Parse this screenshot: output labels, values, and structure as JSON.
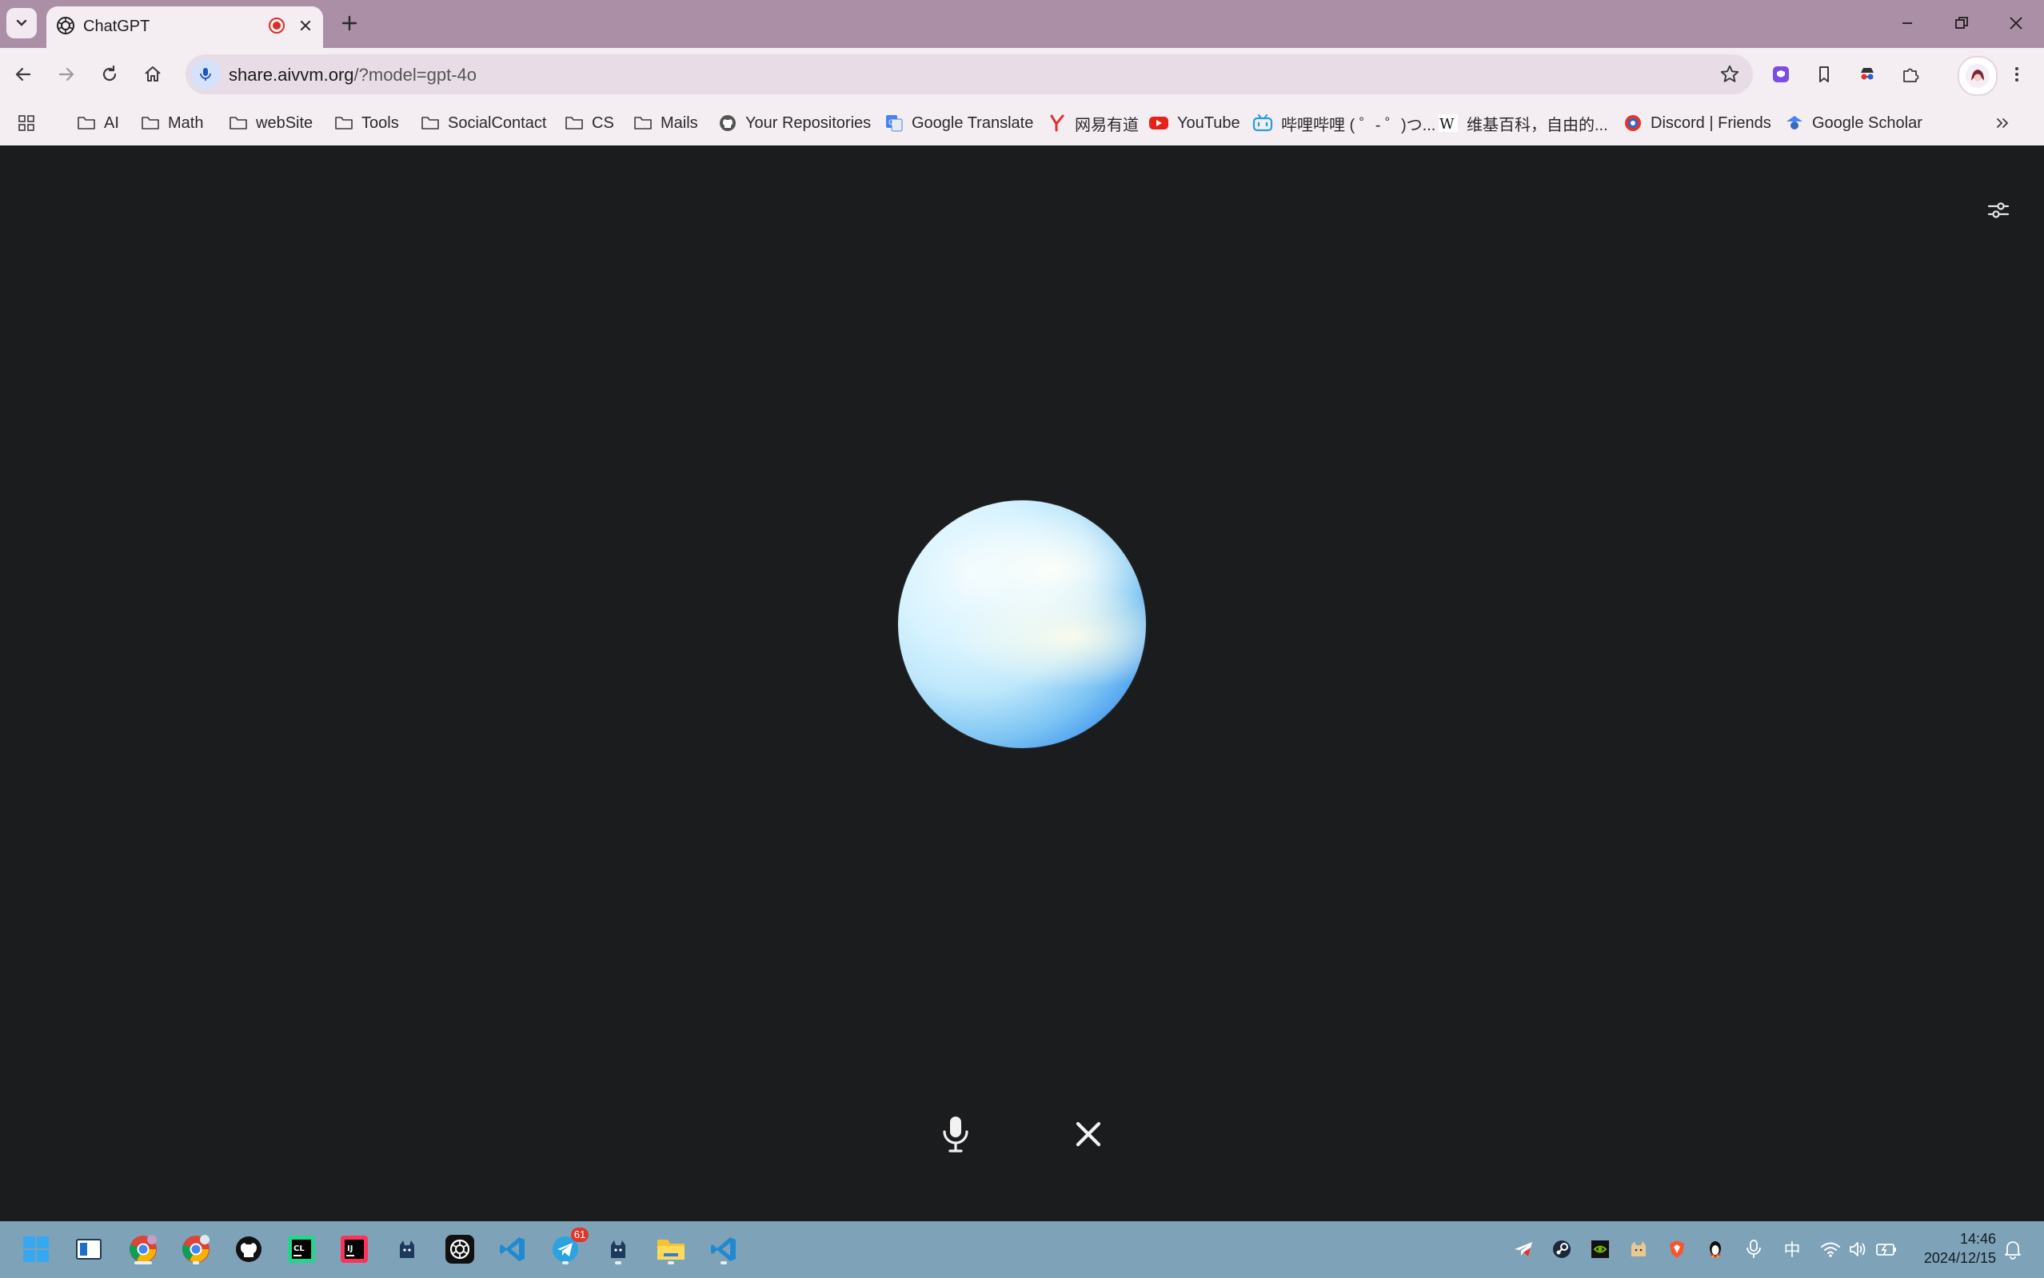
{
  "browser": {
    "tab": {
      "title": "ChatGPT",
      "favicon": "chatgpt-icon"
    },
    "omnibox": {
      "host": "share.aivvm.org",
      "path": "/?model=gpt-4o"
    },
    "bookmarks": [
      {
        "label": "AI",
        "icon": "folder-icon"
      },
      {
        "label": "Math",
        "icon": "folder-icon"
      },
      {
        "label": "webSite",
        "icon": "folder-icon"
      },
      {
        "label": "Tools",
        "icon": "folder-icon"
      },
      {
        "label": "SocialContact",
        "icon": "folder-icon"
      },
      {
        "label": "CS",
        "icon": "folder-icon"
      },
      {
        "label": "Mails",
        "icon": "folder-icon"
      },
      {
        "label": "Your Repositories",
        "icon": "github-icon"
      },
      {
        "label": "Google Translate",
        "icon": "google-translate-icon"
      },
      {
        "label": "网易有道",
        "icon": "youdao-icon"
      },
      {
        "label": "YouTube",
        "icon": "youtube-icon"
      },
      {
        "label": "哔哩哔哩 ( ゜- ゜)つ...",
        "icon": "bilibili-icon"
      },
      {
        "label": "维基百科，自由的...",
        "icon": "wikipedia-icon"
      },
      {
        "label": "Discord | Friends",
        "icon": "discord-icon"
      },
      {
        "label": "Google Scholar",
        "icon": "google-scholar-icon"
      }
    ]
  },
  "voice": {
    "state_orb": "voice-orb",
    "controls": [
      "microphone-icon",
      "close-icon"
    ]
  },
  "taskbar": {
    "telegram_badge": "61",
    "clock_time": "14:46",
    "clock_date": "2024/12/15",
    "ime": "中"
  },
  "colors": {
    "tabstrip": "#aa8fa7",
    "toolbar": "#f4edf2",
    "page_bg": "#1b1c1e",
    "taskbar": "#7ea2b7",
    "orb_blue": "#2a7ff0"
  }
}
